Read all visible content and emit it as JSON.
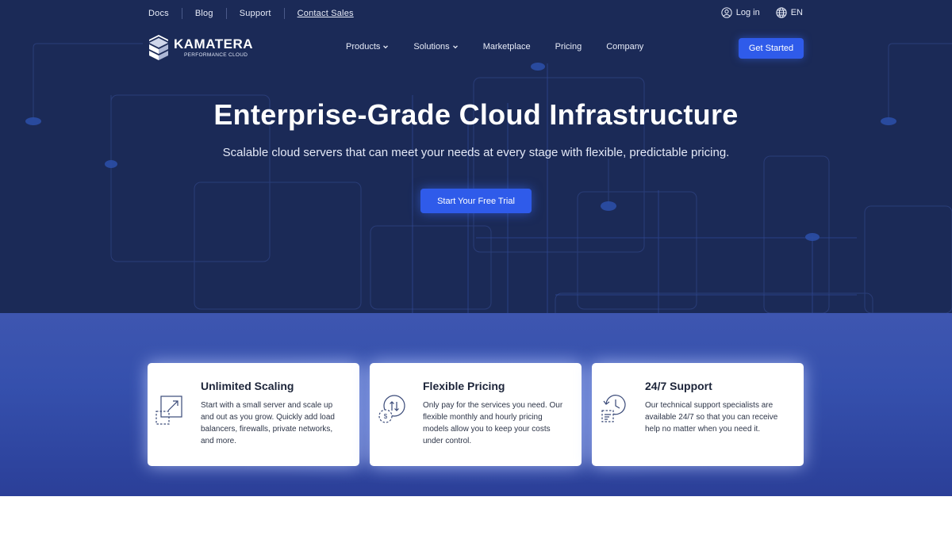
{
  "topbar": {
    "links": [
      "Docs",
      "Blog",
      "Support",
      "Contact Sales"
    ],
    "login": "Log in",
    "language": "EN"
  },
  "logo": {
    "brand": "KAMATERA",
    "tagline": "PERFORMANCE CLOUD"
  },
  "nav": {
    "items": [
      {
        "label": "Products",
        "dropdown": true
      },
      {
        "label": "Solutions",
        "dropdown": true
      },
      {
        "label": "Marketplace",
        "dropdown": false
      },
      {
        "label": "Pricing",
        "dropdown": false
      },
      {
        "label": "Company",
        "dropdown": false
      }
    ],
    "cta": "Get Started"
  },
  "hero": {
    "title": "Enterprise-Grade Cloud Infrastructure",
    "subtitle": "Scalable cloud servers that can meet your needs at every stage with flexible, predictable pricing.",
    "cta": "Start Your Free Trial"
  },
  "features": [
    {
      "title": "Unlimited Scaling",
      "text": "Start with a small server and scale up and out as you grow. Quickly add load balancers, firewalls, private networks, and more.",
      "icon": "scale-icon"
    },
    {
      "title": "Flexible Pricing",
      "text": "Only pay for the services you need. Our flexible monthly and hourly pricing models allow you to keep your costs under control.",
      "icon": "pricing-icon"
    },
    {
      "title": "24/7 Support",
      "text": "Our technical support specialists are available 24/7 so that you can receive help no matter when you need it.",
      "icon": "support-icon"
    }
  ],
  "colors": {
    "hero_bg": "#1b2a57",
    "accent": "#2f5bea",
    "band": "#3550ad"
  }
}
